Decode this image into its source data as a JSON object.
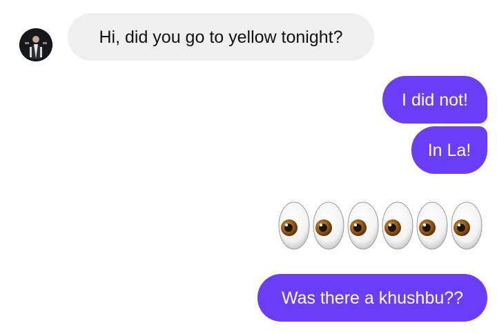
{
  "conversation": {
    "contact_avatar_icon": "person-avatar-icon",
    "messages": [
      {
        "direction": "incoming",
        "text": "Hi, did you go to yellow tonight?"
      },
      {
        "direction": "outgoing",
        "text": "I did not!"
      },
      {
        "direction": "outgoing",
        "text": "In La!"
      },
      {
        "direction": "outgoing",
        "type": "emoji",
        "emoji_count": 6,
        "emoji_icon": "eyes-emoji"
      },
      {
        "direction": "outgoing",
        "text": "Was there a khushbu??"
      }
    ]
  },
  "colors": {
    "outgoing_bubble": "#6a3df8",
    "incoming_bubble": "#efefef",
    "background": "#ffffff"
  }
}
